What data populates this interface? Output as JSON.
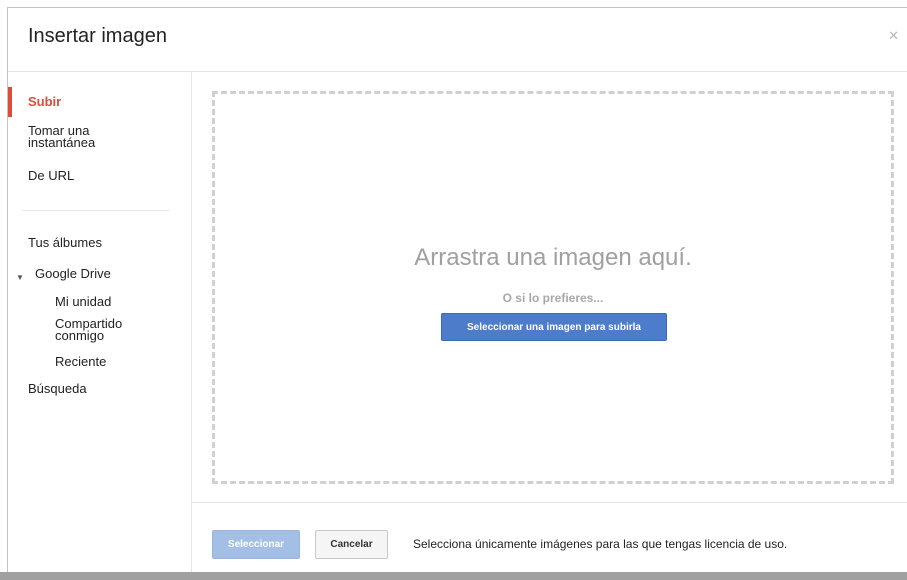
{
  "dialog": {
    "title": "Insertar imagen",
    "close_icon": "close-icon"
  },
  "sidebar": {
    "items": [
      {
        "label": "Subir",
        "active": true
      },
      {
        "label": "Tomar una instantánea"
      },
      {
        "label": "De URL"
      },
      {
        "label": "Tus álbumes"
      },
      {
        "label": "Google Drive",
        "expanded": true
      },
      {
        "label": "Mi unidad"
      },
      {
        "label": "Compartido conmigo"
      },
      {
        "label": "Reciente"
      },
      {
        "label": "Búsqueda"
      }
    ]
  },
  "dropzone": {
    "text": "Arrastra una imagen aquí.",
    "or_text": "O si lo prefieres...",
    "upload_button": "Seleccionar una imagen para subirla"
  },
  "footer": {
    "select_button": "Seleccionar",
    "cancel_button": "Cancelar",
    "note": "Selecciona únicamente imágenes para las que tengas licencia de uso."
  },
  "colors": {
    "accent_red": "#dd4b39",
    "primary_blue": "#4d7ccb",
    "disabled_blue": "#a3bfe6"
  }
}
